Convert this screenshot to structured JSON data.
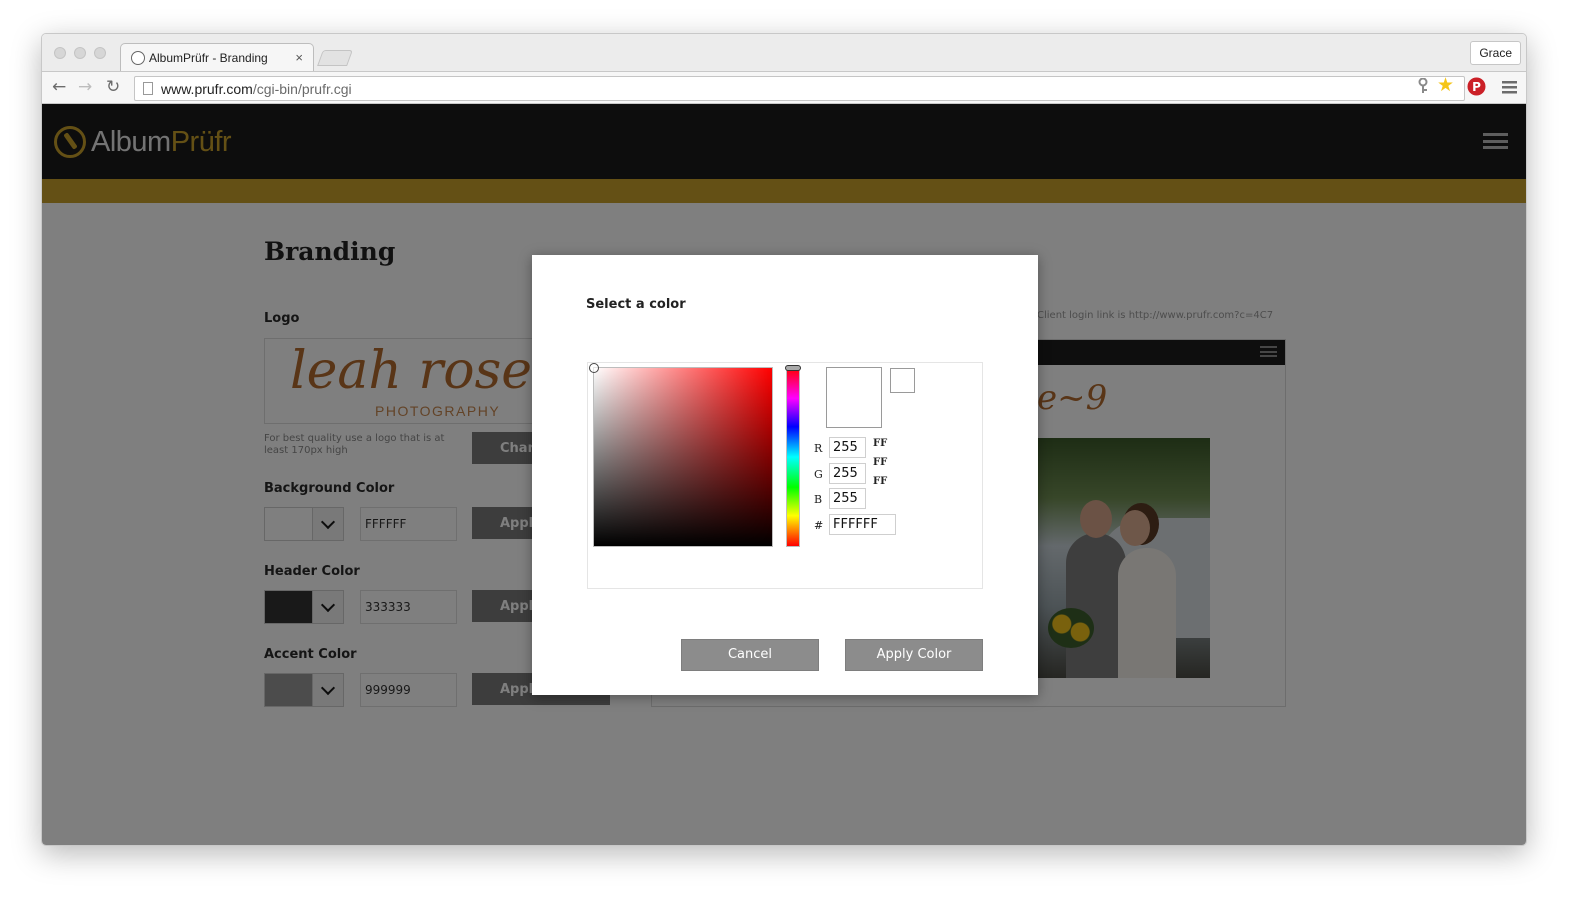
{
  "browser": {
    "tab_title": "AlbumPrüfr - Branding",
    "tab_close": "×",
    "user_name": "Grace",
    "url_host": "www.prufr.com",
    "url_path": "/cgi-bin/prufr.cgi",
    "nav": {
      "back": "←",
      "forward": "→",
      "reload": "↻"
    },
    "icons": {
      "key": "key-icon",
      "star": "star-icon",
      "pinterest": "pinterest-icon",
      "menu": "menu-icon"
    }
  },
  "site": {
    "logo_part1": "Album",
    "logo_part2": "Prüfr",
    "header_color": "#1b1b1b",
    "accent_color": "#c9a12a"
  },
  "page": {
    "title": "Branding",
    "logo_label": "Logo",
    "logo_script": "leah rose",
    "logo_subtitle": "PHOTOGRAPHY",
    "logo_hint": "For best quality use a logo that is at least 170px high",
    "change_button": "Chan",
    "client_login_note": "Client login link is http://www.prufr.com?c=4C7",
    "preview_swirl": "e~9",
    "sections": [
      {
        "label": "Background Color",
        "value": "FFFFFF",
        "swatch": "#ffffff",
        "apply": "Appl"
      },
      {
        "label": "Header Color",
        "value": "333333",
        "swatch": "#333333",
        "apply": "Appl"
      },
      {
        "label": "Accent Color",
        "value": "999999",
        "swatch": "#999999",
        "apply": "Appl"
      }
    ]
  },
  "modal": {
    "title": "Select a color",
    "labels": {
      "r": "R",
      "g": "G",
      "b": "B",
      "hex": "#"
    },
    "r": "255",
    "g": "255",
    "b": "255",
    "hex": "FFFFFF",
    "r_hex": "FF",
    "g_hex": "FF",
    "b_hex": "FF",
    "hue_color": "#ff0000",
    "cancel": "Cancel",
    "apply": "Apply Color"
  }
}
